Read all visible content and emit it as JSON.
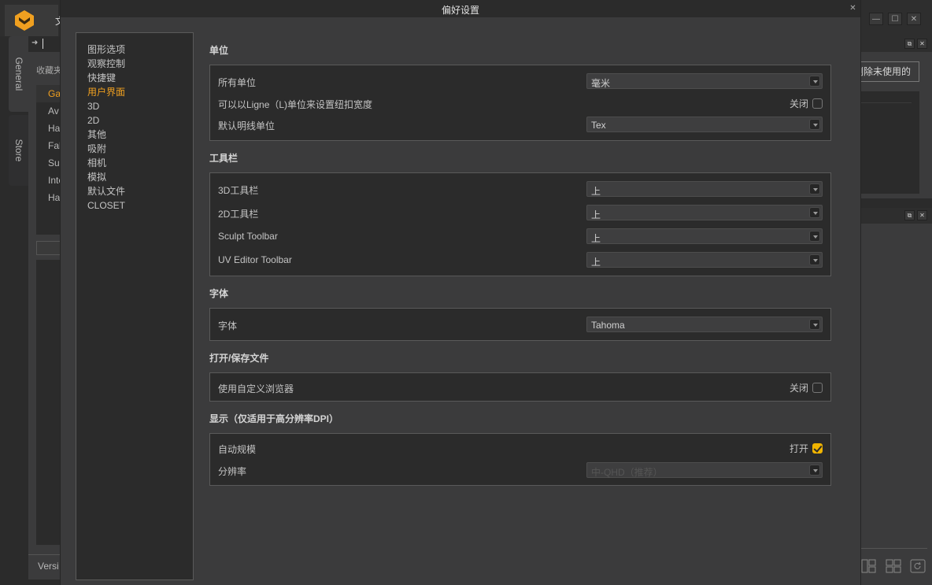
{
  "app": {
    "title_fragment": "文",
    "window_controls": {
      "minimize": "—",
      "maximize": "☐",
      "close": "✕"
    },
    "left_tabs": [
      {
        "label": "General"
      },
      {
        "label": "Store"
      }
    ],
    "library": {
      "path_arrow": "➜",
      "favorites_label": "收藏夹",
      "items": [
        {
          "label": "Ga",
          "active": true
        },
        {
          "label": "Av"
        },
        {
          "label": "Ha"
        },
        {
          "label": "Fal"
        },
        {
          "label": "Su"
        },
        {
          "label": "Inte"
        },
        {
          "label": "Ha"
        }
      ],
      "version_label": "Versi"
    },
    "right_panel": {
      "delete_unused_button": "删除未使用的",
      "popout_icon": "⧉",
      "close_icon": "✕"
    }
  },
  "dialog": {
    "title": "偏好设置",
    "close": "✕",
    "nav": [
      {
        "label": "图形选项"
      },
      {
        "label": "观察控制"
      },
      {
        "label": "快捷键"
      },
      {
        "label": "用户界面",
        "active": true
      },
      {
        "label": "3D"
      },
      {
        "label": "2D"
      },
      {
        "label": "其他"
      },
      {
        "label": "吸附"
      },
      {
        "label": "相机"
      },
      {
        "label": "模拟"
      },
      {
        "label": "默认文件"
      },
      {
        "label": "CLOSET"
      }
    ],
    "sections": {
      "units": {
        "title": "单位",
        "all_units": {
          "label": "所有单位",
          "value": "毫米"
        },
        "ligne": {
          "label": "可以以Ligne（L)单位来设置纽扣宽度",
          "state_label": "关闭",
          "checked": false
        },
        "thread_unit": {
          "label": "默认明线单位",
          "value": "Tex"
        }
      },
      "toolbar": {
        "title": "工具栏",
        "rows": [
          {
            "label": "3D工具栏",
            "value": "上"
          },
          {
            "label": "2D工具栏",
            "value": "上"
          },
          {
            "label": "Sculpt Toolbar",
            "value": "上"
          },
          {
            "label": "UV Editor Toolbar",
            "value": "上"
          }
        ]
      },
      "font": {
        "title": "字体",
        "row": {
          "label": "字体",
          "value": "Tahoma"
        }
      },
      "file": {
        "title": "打开/保存文件",
        "row": {
          "label": "使用自定义浏览器",
          "state_label": "关闭",
          "checked": false
        }
      },
      "display": {
        "title": "显示（仅适用于高分辨率DPI）",
        "auto_scale": {
          "label": "自动规模",
          "state_label": "打开",
          "checked": true
        },
        "resolution": {
          "label": "分辨率",
          "value": "中-QHD（推荐）",
          "disabled": true
        }
      }
    }
  },
  "colors": {
    "accent": "#f0a020",
    "checkbox_on": "#f0b400",
    "panel_bg": "#2b2b2b",
    "dialog_bg": "#3b3b3c"
  }
}
